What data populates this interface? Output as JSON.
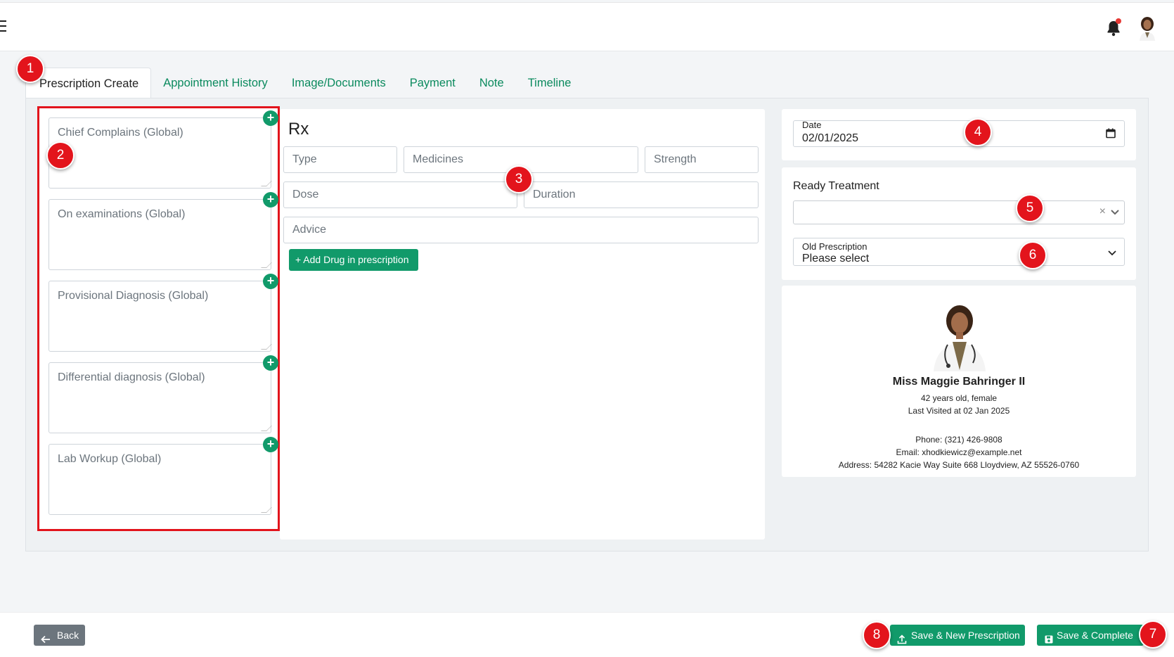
{
  "tabs": [
    {
      "label": "Prescription Create",
      "active": true
    },
    {
      "label": "Appointment History"
    },
    {
      "label": "Image/Documents"
    },
    {
      "label": "Payment"
    },
    {
      "label": "Note"
    },
    {
      "label": "Timeline"
    }
  ],
  "left_fields": [
    {
      "placeholder": "Chief Complains (Global)"
    },
    {
      "placeholder": "On examinations (Global)"
    },
    {
      "placeholder": "Provisional Diagnosis (Global)"
    },
    {
      "placeholder": "Differential diagnosis (Global)"
    },
    {
      "placeholder": "Lab Workup (Global)"
    }
  ],
  "rx": {
    "title": "Rx",
    "type_placeholder": "Type",
    "medicines_placeholder": "Medicines",
    "strength_placeholder": "Strength",
    "dose_placeholder": "Dose",
    "duration_placeholder": "Duration",
    "advice_placeholder": "Advice",
    "add_drug_label": "+ Add Drug in prescription"
  },
  "date": {
    "label": "Date",
    "value": "02/01/2025"
  },
  "ready_treatment": {
    "label": "Ready Treatment",
    "value": "",
    "clear": "×"
  },
  "old_prescription": {
    "label": "Old Prescription",
    "value": "Please select"
  },
  "patient": {
    "name": "Miss Maggie Bahringer II",
    "age_gender": "42 years old, female",
    "last_visit": "Last Visited at 02 Jan 2025",
    "phone": "Phone: (321) 426-9808",
    "email": "Email: xhodkiewicz@example.net",
    "address": "Address: 54282 Kacie Way Suite 668 Lloydview, AZ 55526-0760"
  },
  "footer": {
    "back_label": "Back",
    "save_new_label": "Save & New Prescription",
    "save_complete_label": "Save & Complete"
  },
  "callouts": [
    "1",
    "2",
    "3",
    "4",
    "5",
    "6",
    "7",
    "8"
  ],
  "colors": {
    "accent": "#119a6a",
    "callout": "#e3141c",
    "highlight_border": "#e2141c"
  }
}
